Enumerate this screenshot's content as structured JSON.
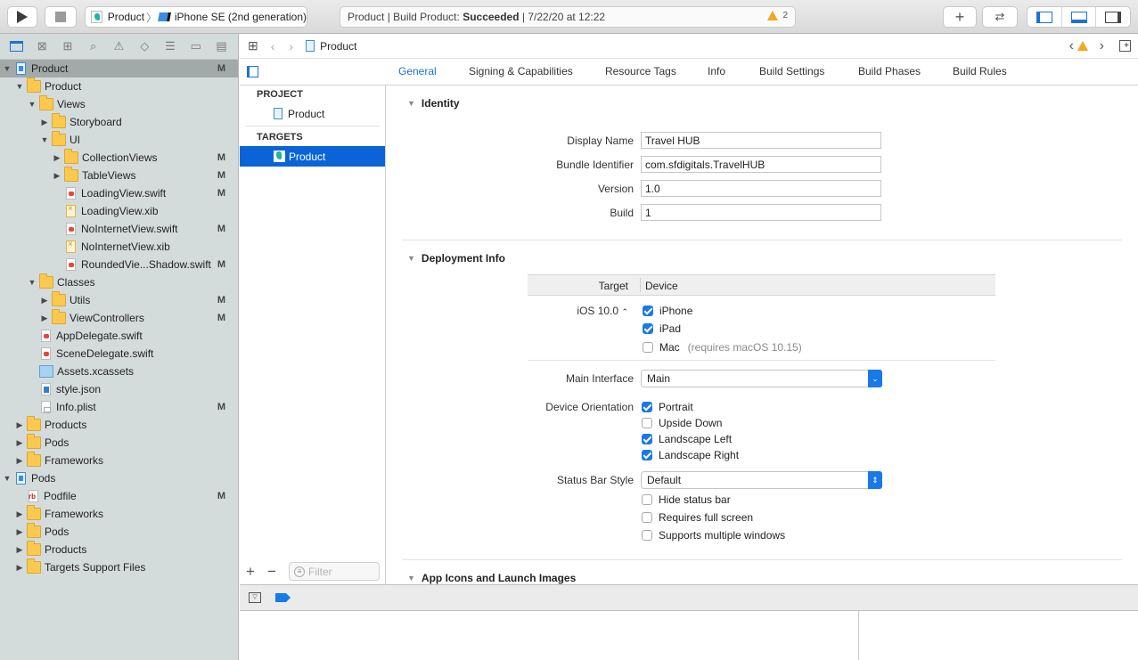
{
  "toolbar": {
    "run_label": "Run",
    "stop_label": "Stop",
    "scheme": {
      "target": "Product",
      "separator": "〉",
      "device": "iPhone SE (2nd generation)"
    },
    "status": {
      "prefix": "Product | Build Product: ",
      "result": "Succeeded",
      "suffix": " | 7/22/20 at 12:22",
      "warning_count": "2"
    },
    "add_label": "+",
    "accent": "#1a72d8",
    "warning_color": "#f5a623"
  },
  "navigator": {
    "tabs": [
      "project-navigator",
      "source-control-navigator",
      "symbol-navigator",
      "find-navigator",
      "issue-navigator",
      "test-navigator",
      "debug-navigator",
      "breakpoint-navigator",
      "report-navigator"
    ],
    "items": [
      {
        "label": "Product",
        "badge": "M",
        "type": "project",
        "level": 0,
        "disclosure": "open",
        "selected": true
      },
      {
        "label": "Product",
        "badge": "",
        "type": "folder",
        "level": 1,
        "disclosure": "open"
      },
      {
        "label": "Views",
        "badge": "",
        "type": "folder",
        "level": 2,
        "disclosure": "open"
      },
      {
        "label": "Storyboard",
        "badge": "",
        "type": "folder",
        "level": 3,
        "disclosure": "closed"
      },
      {
        "label": "UI",
        "badge": "",
        "type": "folder",
        "level": 3,
        "disclosure": "open"
      },
      {
        "label": "CollectionViews",
        "badge": "M",
        "type": "folder",
        "level": 4,
        "disclosure": "closed"
      },
      {
        "label": "TableViews",
        "badge": "M",
        "type": "folder",
        "level": 4,
        "disclosure": "closed"
      },
      {
        "label": "LoadingView.swift",
        "badge": "M",
        "type": "swift",
        "level": 4,
        "disclosure": ""
      },
      {
        "label": "LoadingView.xib",
        "badge": "",
        "type": "xib",
        "level": 4,
        "disclosure": ""
      },
      {
        "label": "NoInternetView.swift",
        "badge": "M",
        "type": "swift",
        "level": 4,
        "disclosure": ""
      },
      {
        "label": "NoInternetView.xib",
        "badge": "",
        "type": "xib",
        "level": 4,
        "disclosure": ""
      },
      {
        "label": "RoundedVie...Shadow.swift",
        "badge": "M",
        "type": "swift",
        "level": 4,
        "disclosure": ""
      },
      {
        "label": "Classes",
        "badge": "",
        "type": "folder",
        "level": 2,
        "disclosure": "open"
      },
      {
        "label": "Utils",
        "badge": "M",
        "type": "folder",
        "level": 3,
        "disclosure": "closed"
      },
      {
        "label": "ViewControllers",
        "badge": "M",
        "type": "folder",
        "level": 3,
        "disclosure": "closed"
      },
      {
        "label": "AppDelegate.swift",
        "badge": "",
        "type": "swift",
        "level": 2,
        "disclosure": ""
      },
      {
        "label": "SceneDelegate.swift",
        "badge": "",
        "type": "swift",
        "level": 2,
        "disclosure": ""
      },
      {
        "label": "Assets.xcassets",
        "badge": "",
        "type": "assets",
        "level": 2,
        "disclosure": ""
      },
      {
        "label": "style.json",
        "badge": "",
        "type": "json",
        "level": 2,
        "disclosure": ""
      },
      {
        "label": "Info.plist",
        "badge": "M",
        "type": "plist",
        "level": 2,
        "disclosure": ""
      },
      {
        "label": "Products",
        "badge": "",
        "type": "folder",
        "level": 1,
        "disclosure": "closed"
      },
      {
        "label": "Pods",
        "badge": "",
        "type": "folder",
        "level": 1,
        "disclosure": "closed"
      },
      {
        "label": "Frameworks",
        "badge": "",
        "type": "folder",
        "level": 1,
        "disclosure": "closed"
      },
      {
        "label": "Pods",
        "badge": "",
        "type": "project",
        "level": 0,
        "disclosure": "open"
      },
      {
        "label": "Podfile",
        "badge": "M",
        "type": "rb",
        "level": 1,
        "disclosure": ""
      },
      {
        "label": "Frameworks",
        "badge": "",
        "type": "folder",
        "level": 1,
        "disclosure": "closed"
      },
      {
        "label": "Pods",
        "badge": "",
        "type": "folder",
        "level": 1,
        "disclosure": "closed"
      },
      {
        "label": "Products",
        "badge": "",
        "type": "folder",
        "level": 1,
        "disclosure": "closed"
      },
      {
        "label": "Targets Support Files",
        "badge": "",
        "type": "folder",
        "level": 1,
        "disclosure": "closed"
      }
    ]
  },
  "editor": {
    "breadcrumb": "Product",
    "tabs": [
      {
        "label": "General",
        "active": true
      },
      {
        "label": "Signing & Capabilities"
      },
      {
        "label": "Resource Tags"
      },
      {
        "label": "Info"
      },
      {
        "label": "Build Settings"
      },
      {
        "label": "Build Phases"
      },
      {
        "label": "Build Rules"
      }
    ],
    "project_header": "PROJECT",
    "project_item": "Product",
    "targets_header": "TARGETS",
    "target_item": "Product",
    "filter_placeholder": "Filter",
    "identity": {
      "title": "Identity",
      "fields": [
        {
          "label": "Display Name",
          "value": "Travel HUB"
        },
        {
          "label": "Bundle Identifier",
          "value": "com.sfdigitals.TravelHUB"
        },
        {
          "label": "Version",
          "value": "1.0"
        },
        {
          "label": "Build",
          "value": "1"
        }
      ]
    },
    "deployment": {
      "title": "Deployment Info",
      "col_target": "Target",
      "col_device": "Device",
      "ios_version": "iOS 10.0",
      "devices": [
        {
          "label": "iPhone",
          "checked": true
        },
        {
          "label": "iPad",
          "checked": true
        },
        {
          "label": "Mac",
          "note": "(requires macOS 10.15)",
          "checked": false
        }
      ],
      "main_interface_label": "Main Interface",
      "main_interface_value": "Main",
      "orientation_label": "Device Orientation",
      "orientations": [
        {
          "label": "Portrait",
          "checked": true
        },
        {
          "label": "Upside Down",
          "checked": false
        },
        {
          "label": "Landscape Left",
          "checked": true
        },
        {
          "label": "Landscape Right",
          "checked": true
        }
      ],
      "status_bar_label": "Status Bar Style",
      "status_bar_value": "Default",
      "status_options": [
        {
          "label": "Hide status bar",
          "checked": false
        },
        {
          "label": "Requires full screen",
          "checked": false
        },
        {
          "label": "Supports multiple windows",
          "checked": false
        }
      ]
    },
    "app_icons_title": "App Icons and Launch Images"
  }
}
